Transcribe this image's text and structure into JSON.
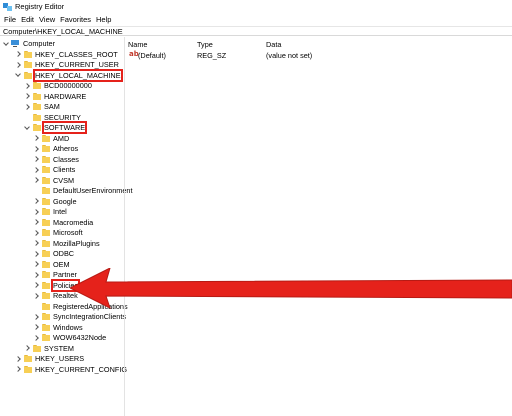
{
  "window": {
    "title": "Registry Editor"
  },
  "menu": [
    "File",
    "Edit",
    "View",
    "Favorites",
    "Help"
  ],
  "address": "Computer\\HKEY_LOCAL_MACHINE",
  "list": {
    "columns": {
      "name": "Name",
      "type": "Type",
      "data": "Data"
    },
    "rows": [
      {
        "name": "(Default)",
        "type": "REG_SZ",
        "data": "(value not set)"
      }
    ]
  },
  "tree": [
    {
      "label": "Computer",
      "depth": 0,
      "expander": "down",
      "icon": "computer-icon"
    },
    {
      "label": "HKEY_CLASSES_ROOT",
      "depth": 1,
      "expander": "right",
      "icon": "folder-icon"
    },
    {
      "label": "HKEY_CURRENT_USER",
      "depth": 1,
      "expander": "right",
      "icon": "folder-icon"
    },
    {
      "label": "HKEY_LOCAL_MACHINE",
      "depth": 1,
      "expander": "down",
      "icon": "folder-icon",
      "highlighted": true
    },
    {
      "label": "BCD00000000",
      "depth": 2,
      "expander": "right",
      "icon": "folder-icon"
    },
    {
      "label": "HARDWARE",
      "depth": 2,
      "expander": "right",
      "icon": "folder-icon"
    },
    {
      "label": "SAM",
      "depth": 2,
      "expander": "right",
      "icon": "folder-icon"
    },
    {
      "label": "SECURITY",
      "depth": 2,
      "expander": "none",
      "icon": "folder-icon"
    },
    {
      "label": "SOFTWARE",
      "depth": 2,
      "expander": "down",
      "icon": "folder-icon",
      "highlighted": true
    },
    {
      "label": "AMD",
      "depth": 3,
      "expander": "right",
      "icon": "folder-icon"
    },
    {
      "label": "Atheros",
      "depth": 3,
      "expander": "right",
      "icon": "folder-icon"
    },
    {
      "label": "Classes",
      "depth": 3,
      "expander": "right",
      "icon": "folder-icon"
    },
    {
      "label": "Clients",
      "depth": 3,
      "expander": "right",
      "icon": "folder-icon"
    },
    {
      "label": "CVSM",
      "depth": 3,
      "expander": "right",
      "icon": "folder-icon"
    },
    {
      "label": "DefaultUserEnvironment",
      "depth": 3,
      "expander": "none",
      "icon": "folder-icon"
    },
    {
      "label": "Google",
      "depth": 3,
      "expander": "right",
      "icon": "folder-icon"
    },
    {
      "label": "Intel",
      "depth": 3,
      "expander": "right",
      "icon": "folder-icon"
    },
    {
      "label": "Macromedia",
      "depth": 3,
      "expander": "right",
      "icon": "folder-icon"
    },
    {
      "label": "Microsoft",
      "depth": 3,
      "expander": "right",
      "icon": "folder-icon"
    },
    {
      "label": "MozillaPlugins",
      "depth": 3,
      "expander": "right",
      "icon": "folder-icon"
    },
    {
      "label": "ODBC",
      "depth": 3,
      "expander": "right",
      "icon": "folder-icon"
    },
    {
      "label": "OEM",
      "depth": 3,
      "expander": "right",
      "icon": "folder-icon"
    },
    {
      "label": "Partner",
      "depth": 3,
      "expander": "right",
      "icon": "folder-icon"
    },
    {
      "label": "Policies",
      "depth": 3,
      "expander": "right",
      "icon": "folder-icon",
      "highlighted": true
    },
    {
      "label": "Realtek",
      "depth": 3,
      "expander": "right",
      "icon": "folder-icon"
    },
    {
      "label": "RegisteredApplications",
      "depth": 3,
      "expander": "none",
      "icon": "folder-icon"
    },
    {
      "label": "SyncIntegrationClients",
      "depth": 3,
      "expander": "right",
      "icon": "folder-icon"
    },
    {
      "label": "Windows",
      "depth": 3,
      "expander": "right",
      "icon": "folder-icon"
    },
    {
      "label": "WOW6432Node",
      "depth": 3,
      "expander": "right",
      "icon": "folder-icon"
    },
    {
      "label": "SYSTEM",
      "depth": 2,
      "expander": "right",
      "icon": "folder-icon"
    },
    {
      "label": "HKEY_USERS",
      "depth": 1,
      "expander": "right",
      "icon": "folder-icon"
    },
    {
      "label": "HKEY_CURRENT_CONFIG",
      "depth": 1,
      "expander": "right",
      "icon": "folder-icon"
    }
  ],
  "colors": {
    "highlight": "#e5221b",
    "arrow": "#e5221b",
    "folder": "#f7cf55"
  }
}
